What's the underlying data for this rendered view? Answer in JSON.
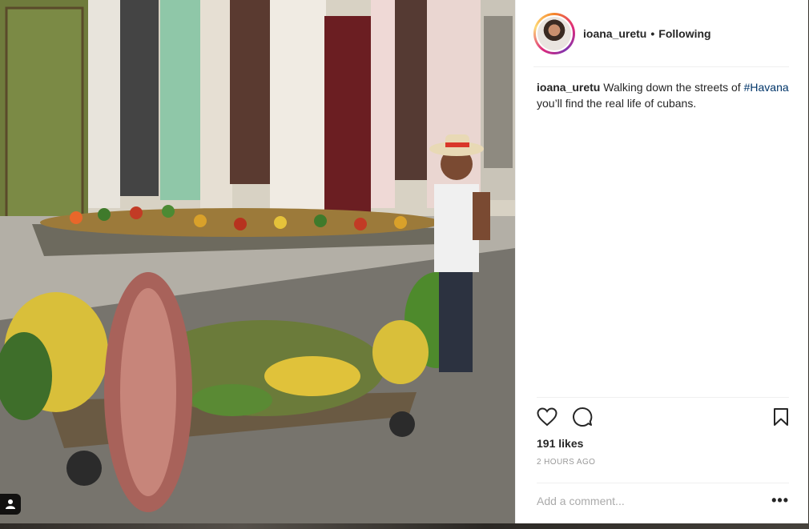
{
  "post": {
    "author": "ioana_uretu",
    "separator": "•",
    "follow_status": "Following",
    "caption": {
      "user": "ioana_uretu",
      "text_before": " Walking down the streets of ",
      "hashtag": "#Havana",
      "text_after": " you’ll find the real life of cubans."
    },
    "likes": "191 likes",
    "time": "2 HOURS AGO",
    "comment_placeholder": "Add a comment...",
    "more_options": "•••"
  },
  "icons": {
    "like": "heart-icon",
    "comment": "comment-bubble-icon",
    "save": "bookmark-icon",
    "tag": "user-tag-icon"
  },
  "colors": {
    "hashtag": "#003569",
    "text": "#262626",
    "muted": "#999999",
    "divider": "#efefef"
  }
}
